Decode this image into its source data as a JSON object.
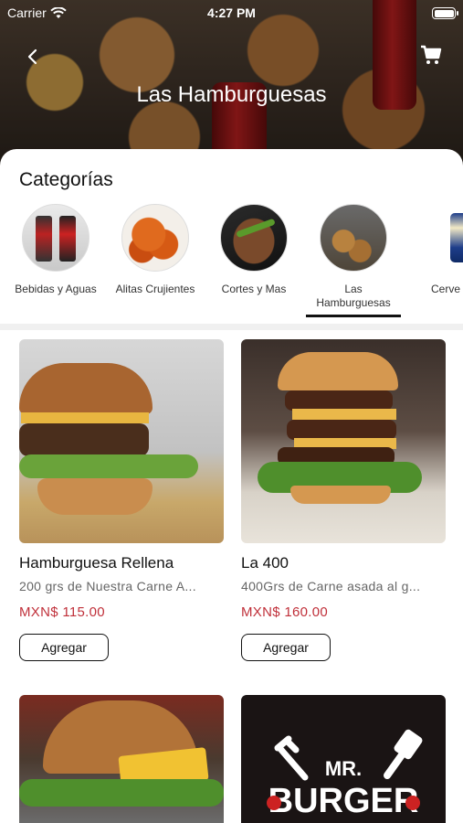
{
  "status_bar": {
    "carrier": "Carrier",
    "time": "4:27 PM"
  },
  "header": {
    "title": "Las Hamburguesas"
  },
  "categories_section": {
    "heading": "Categorías",
    "items": [
      {
        "label": "Bebidas y Aguas",
        "icon": "drinks-image"
      },
      {
        "label": "Alitas Crujientes",
        "icon": "wings-image"
      },
      {
        "label": "Cortes y Mas",
        "icon": "steak-image"
      },
      {
        "label": "Las Hamburguesas",
        "icon": "burger-image",
        "selected": true
      },
      {
        "label": "Cerve",
        "icon": "beer-image"
      }
    ]
  },
  "products": [
    {
      "name": "Hamburguesa Rellena",
      "description": "200 grs de Nuestra Carne A...",
      "price": "MXN$ 115.00",
      "button": "Agregar"
    },
    {
      "name": "La 400",
      "description": "400Grs de Carne asada al g...",
      "price": "MXN$ 160.00",
      "button": "Agregar"
    },
    {
      "name": "",
      "description": "",
      "price": "",
      "button": ""
    },
    {
      "name": "",
      "description": "",
      "price": "",
      "button": "",
      "logo_text": "MR. BURGER"
    }
  ],
  "colors": {
    "price": "#c0303a",
    "accent": "#111111"
  }
}
